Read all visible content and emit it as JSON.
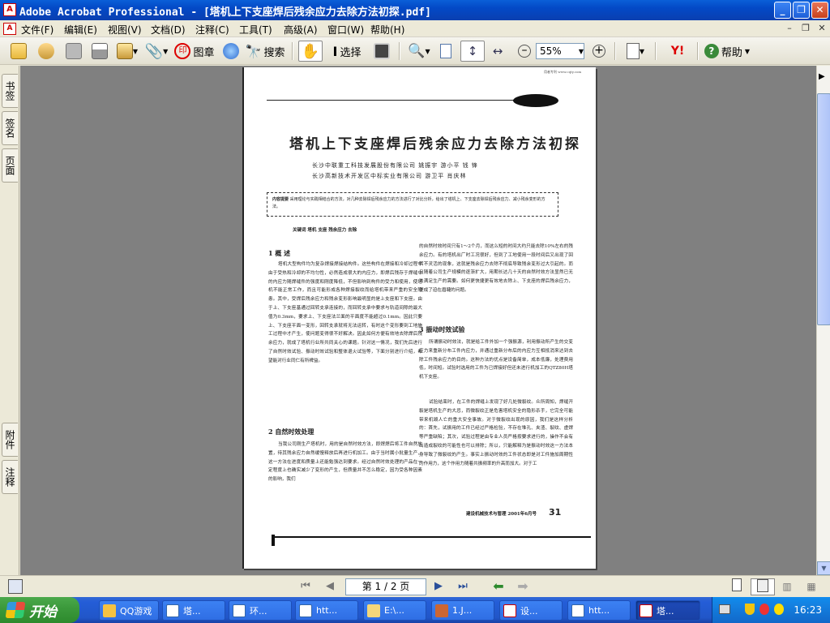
{
  "window": {
    "title": "Adobe Acrobat Professional - [塔机上下支座焊后残余应力去除方法初探.pdf]",
    "app_icon": "acrobat-icon",
    "buttons": [
      "minimize",
      "restore",
      "close"
    ]
  },
  "menu": {
    "items": [
      "文件(F)",
      "编辑(E)",
      "视图(V)",
      "文档(D)",
      "注释(C)",
      "工具(T)",
      "高级(A)",
      "窗口(W)",
      "帮助(H)"
    ]
  },
  "toolbar": {
    "stamp_label": "图章",
    "search_label": "搜索",
    "select_label": "选择",
    "zoom_value": "55%",
    "help_label": "帮助",
    "yahoo_label": "Y!"
  },
  "left_tabs": {
    "top": [
      "书签",
      "签名",
      "页面"
    ],
    "bottom": [
      "附件",
      "注释"
    ]
  },
  "document": {
    "url_header": "用者专利 www.cqty.com",
    "title": "塔机上下支座焊后残余应力去除方法初探",
    "authors_line1": "长沙中联重工科技发展股份有限公司   姚振宇   游小平   钱   锋",
    "authors_line2": "长沙高新技术开发区中标实业有限公司   游卫平   肖庆林",
    "abstract_label": "内容提要",
    "abstract_text": "采用理论与实践相结合的方法，对几种去除焊后残余应力的方法进行了对比分析，给出了塔机上、下支座去除焊后残余应力、减小残余变形的方法。",
    "keywords": "关键词   塔机   支座   残余应力   去除",
    "section1_heading": "1   概   述",
    "section1_text": "塔机大型构件均为复杂焊接焊接结构件。这些构件在焊接和冷却过程中由于受热和冷却的不均匀性，必然造成很大的内应力，即焊后残存于焊缝中的内应力随焊缝件的强度和刚度降低，不但影响到构件的受力和使用，使塔机不能正常工作，而且可能形成各种焊接裂纹而给塔机带来严重的安全隐患。其中，受焊后残余应力和残余变形影响最明显的是上支座和下支座。由于上、下支座基通过回转支承连接的，而回转支承中要求与轨道间隙的最大值为0.3mm，要求上、下支座法兰面的平面度不能超过0.1mm。因此只要上、下支座平面一变形，回转支承就将无法运转，有时这个变形要到工地施工过程中才产生，使问题变得很不好解决。因此如何方便有效地去除焊后残余应力，就成了塔机行业所共同关心的课题。针对这一情况，我们先后进行了自然时效试验、振动时效试验和整体退火试验等，下面分别进行介绍，希望能对行业同仁有所裨益。",
    "section2_heading": "2   自然时效处理",
    "section2_text": "当我公司刚生产塔机时，用的是自然时效方法，即焊焊后将工件自然放置，待其残余应力自然缓慢释放后再进行机加工。由于当时属小批量生产，这一方法在进度和质量上还能勉强达到要求。经过自然时效处理的产品在一定程度上也确实减少了变形的产生，但质量并不怎么稳定，因为受各种因素的影响，我们",
    "col2_text1": "的自然时效时间只有1～2个月，而这么短的时间大约只能去除10%左右的残余应力。有的塔机出厂时工况很好，但到了工地使用一段时间后又出现了回转不灵活的现象，这就是残余应力去除不彻底导致残余变形过大引起的。而且随着公司生产规模的逐渐扩大，用期长达几十天的自然时效方法显然已无法满足生产的需要。如何更快捷更有效地去除上、下支座的焊后残余应力，便成了迫在眉睫的问题。",
    "section3_heading": "3   振动时效试验",
    "col2_text2": "所谓振动时效法，就是给工件外加一个强振源，利用振动所产生的交变应力来重新分布工件内应力，并通过重新分布后的内应力互相抵消来达到去除工件残余应力的目的。这种方法的优点是设备简单，成本低廉，处理费用低，时间短。试验时选用的工件为已焊接好但还未进行机加工的QTZ80H塔机下支座。",
    "col2_text3": "试验结束时，在工件的焊缝上发现了好几处微裂纹。众所周知，焊缝开裂是塔机生产的大忌，而微裂纹正是危害塔机安全的隐形杀手，它完全可能带来机毁人亡的重大安全事故。对于微裂纹出现的原因，我们是这样分析的：首先，试振用的工件已经过严格检验，不存在堆孔、夹渣、裂纹、虚焊等严重缺陷；其次，试验过程是由专业人员严格按要求进行的，操作不会有出造成裂纹的可能性也可以排除；所以，只能解释为是振动时效这一方法本身导致了微裂纹的产生。事实上振动时效的工件状态即是对工件施加周期性的作用力，这个作用力随着共振频率的升高而加大。对于工",
    "footer_journal": "建设机械技术与管理   2001年6月号",
    "page_number": "31"
  },
  "statusbar": {
    "page_indicator": "第 1 / 2 页"
  },
  "taskbar": {
    "start_label": "开始",
    "tasks": [
      "QQ游戏",
      "塔...",
      "环...",
      "htt...",
      "E:\\...",
      "1.J...",
      "设...",
      "htt...",
      "塔..."
    ],
    "clock": "16:23"
  }
}
